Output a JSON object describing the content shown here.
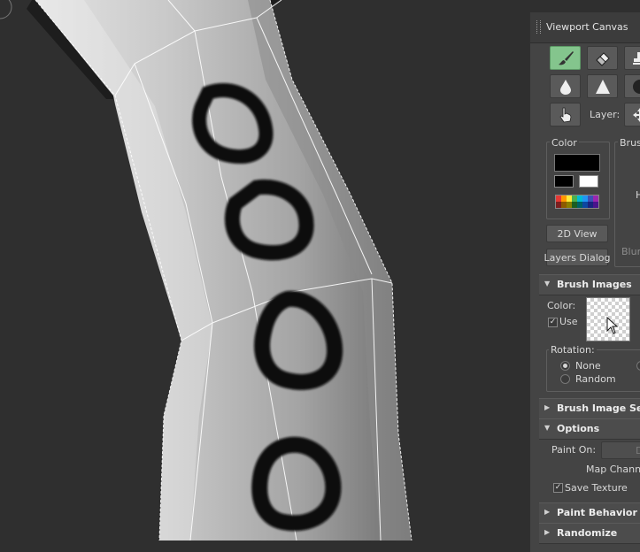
{
  "panel": {
    "title": "Viewport Canvas",
    "layer_label": "Layer:",
    "color_group_label": "Color",
    "brush_group_label": "Brush",
    "brush_group_h": "H",
    "blur_label": "Blur/",
    "view2d_button": "2D View",
    "layers_dialog_button": "Layers Dialog",
    "primary_color": "#000000",
    "secondary_colors": [
      "#000000",
      "#ffffff"
    ],
    "accent_color": "#84c58d"
  },
  "tools": [
    "paint-brush",
    "eraser",
    "clone-stamp",
    "drop",
    "triangle",
    "circle",
    "hand",
    "move"
  ],
  "rollouts": {
    "brush_images": {
      "title": "Brush Images",
      "color_label": "Color:",
      "use_label": "Use",
      "use_checked": true,
      "rotation_label": "Rotation:",
      "rotation_options": [
        "None",
        "Random"
      ],
      "rotation_selected": "None"
    },
    "brush_image_settings": {
      "title": "Brush Image Set"
    },
    "options": {
      "title": "Options",
      "paint_on_label": "Paint On:",
      "paint_on_value": "D",
      "map_channel_label": "Map Channel",
      "save_texture_label": "Save Texture",
      "save_texture_checked": true
    },
    "paint_behavior": {
      "title": "Paint Behavior"
    },
    "randomize": {
      "title": "Randomize"
    }
  }
}
